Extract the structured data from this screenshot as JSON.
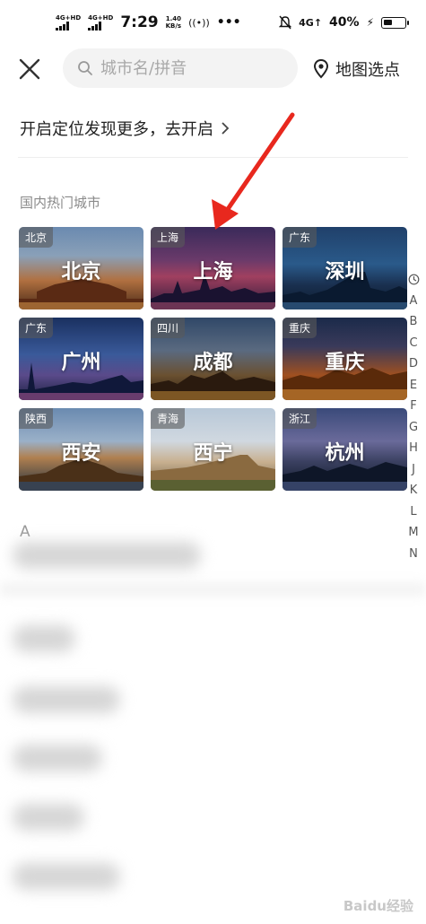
{
  "status_bar": {
    "network1": "4G+HD",
    "network2": "4G+HD",
    "time": "7:29",
    "speed_value": "1.40",
    "speed_unit": "KB/s",
    "mobile_data": "4G↑",
    "battery": "40%"
  },
  "header": {
    "search_placeholder": "城市名/拼音",
    "map_pick_label": "地图选点"
  },
  "location_prompt": "开启定位发现更多，去开启",
  "hot_cities_title": "国内热门城市",
  "cities": [
    {
      "province": "北京",
      "name": "北京"
    },
    {
      "province": "上海",
      "name": "上海"
    },
    {
      "province": "广东",
      "name": "深圳"
    },
    {
      "province": "广东",
      "name": "广州"
    },
    {
      "province": "四川",
      "name": "成都"
    },
    {
      "province": "重庆",
      "name": "重庆"
    },
    {
      "province": "陕西",
      "name": "西安"
    },
    {
      "province": "青海",
      "name": "西宁"
    },
    {
      "province": "浙江",
      "name": "杭州"
    }
  ],
  "index_letters": [
    "A",
    "B",
    "C",
    "D",
    "E",
    "F",
    "G",
    "H",
    "J",
    "K",
    "L",
    "M",
    "N"
  ],
  "section_letter": "A",
  "watermark": "Baidu经验",
  "colors": {
    "annotation_arrow": "#e8281e",
    "search_bg": "#f3f3f3"
  }
}
